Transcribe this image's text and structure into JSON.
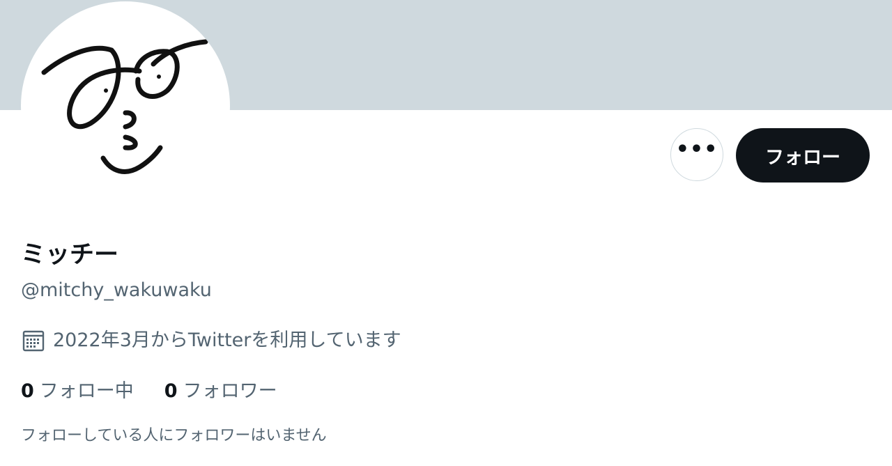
{
  "profile": {
    "display_name": "ミッチー",
    "handle": "@mitchy_wakuwaku",
    "joined": "2022年3月からTwitterを利用しています",
    "following_count": "0",
    "following_label": "フォロー中",
    "followers_count": "0",
    "followers_label": "フォロワー",
    "mutuals_note": "フォローしている人にフォロワーはいません"
  },
  "actions": {
    "more_label": "•••",
    "follow_label": "フォロー"
  },
  "icons": {
    "more": "more-dots-icon",
    "calendar": "calendar-icon",
    "avatar": "hand-drawn-face"
  },
  "colors": {
    "banner": "#cfd9de",
    "primary_text": "#0f1419",
    "secondary_text": "#536471",
    "follow_button_bg": "#0f1419",
    "follow_button_text": "#ffffff"
  }
}
